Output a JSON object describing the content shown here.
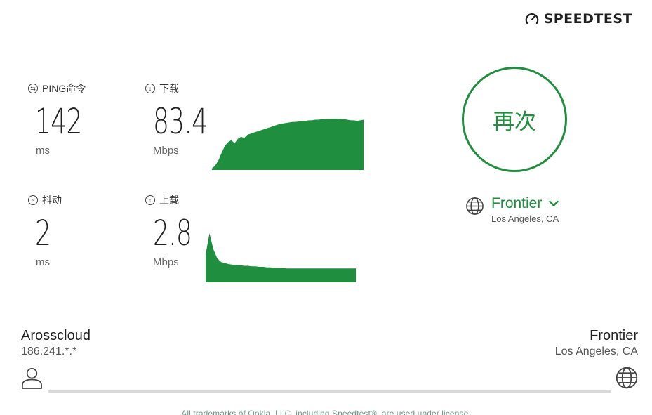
{
  "brand": {
    "name": "SPEEDTEST",
    "icon": "gauge-icon"
  },
  "metrics": {
    "ping": {
      "label": "PING命令",
      "value": "142",
      "unit": "ms",
      "icon": "ping-icon"
    },
    "download": {
      "label": "下载",
      "value": "83.4",
      "unit": "Mbps",
      "icon": "arrow-down-circle-icon"
    },
    "jitter": {
      "label": "抖动",
      "value": "2",
      "unit": "ms",
      "icon": "wave-icon"
    },
    "upload": {
      "label": "上载",
      "value": "2.8",
      "unit": "Mbps",
      "icon": "arrow-up-circle-icon"
    }
  },
  "again_button": {
    "label": "再次"
  },
  "server": {
    "name": "Frontier",
    "location": "Los Angeles, CA",
    "icon": "globe-icon",
    "dropdown_icon": "chevron-down-icon"
  },
  "isp": {
    "name": "Arosscloud",
    "ip": "186.241.*.*"
  },
  "host": {
    "name": "Frontier",
    "location": "Los Angeles, CA"
  },
  "footer": {
    "text": "All trademarks of Ookla, LLC, including Speedtest®, are used under license."
  },
  "colors": {
    "accent": "#1f8e3e",
    "graph": "#1f8e3e",
    "divider": "#d9d9d9"
  },
  "download_series": [
    0.03,
    0.08,
    0.18,
    0.32,
    0.45,
    0.52,
    0.56,
    0.5,
    0.58,
    0.62,
    0.6,
    0.66,
    0.68,
    0.7,
    0.72,
    0.74,
    0.76,
    0.78,
    0.8,
    0.82,
    0.84,
    0.86,
    0.87,
    0.88,
    0.89,
    0.9,
    0.9,
    0.91,
    0.92,
    0.92,
    0.93,
    0.93,
    0.94,
    0.94,
    0.95,
    0.95,
    0.95,
    0.96,
    0.96,
    0.96,
    0.96,
    0.95,
    0.94,
    0.93,
    0.93,
    0.92,
    0.93,
    0.94
  ],
  "upload_series": [
    0.52,
    0.92,
    0.62,
    0.45,
    0.38,
    0.36,
    0.34,
    0.33,
    0.32,
    0.32,
    0.31,
    0.31,
    0.3,
    0.3,
    0.29,
    0.29,
    0.28,
    0.28,
    0.27,
    0.27,
    0.27,
    0.26,
    0.26,
    0.26,
    0.26,
    0.26,
    0.26,
    0.26,
    0.26,
    0.26,
    0.26,
    0.26,
    0.26,
    0.26,
    0.26,
    0.26,
    0.26,
    0.26,
    0.26,
    0.26
  ]
}
